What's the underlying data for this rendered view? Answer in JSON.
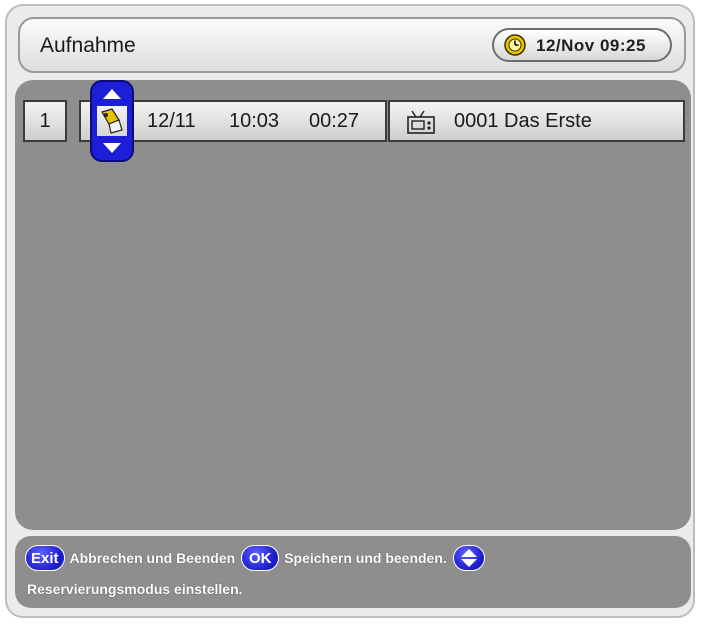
{
  "header": {
    "title": "Aufnahme",
    "clock": "12/Nov 09:25",
    "clock_icon": "clock-icon"
  },
  "reservation": {
    "index": "1",
    "mode_icon": "recording-mode-icon",
    "date": "12/11",
    "start_time": "10:03",
    "duration": "00:27",
    "channel_icon": "tv-channel-icon",
    "channel": "0001 Das Erste"
  },
  "footer": {
    "exit_label": "Exit",
    "exit_text": "Abbrechen und Beenden",
    "ok_label": "OK",
    "ok_text": "Speichern und beenden.",
    "nav_icon": "up-down-arrows-icon",
    "hint": "Reservierungsmodus einstellen."
  },
  "colors": {
    "panel": "#8e8e8e",
    "accent": "#1d1ed6",
    "text_light": "#ffffff"
  }
}
